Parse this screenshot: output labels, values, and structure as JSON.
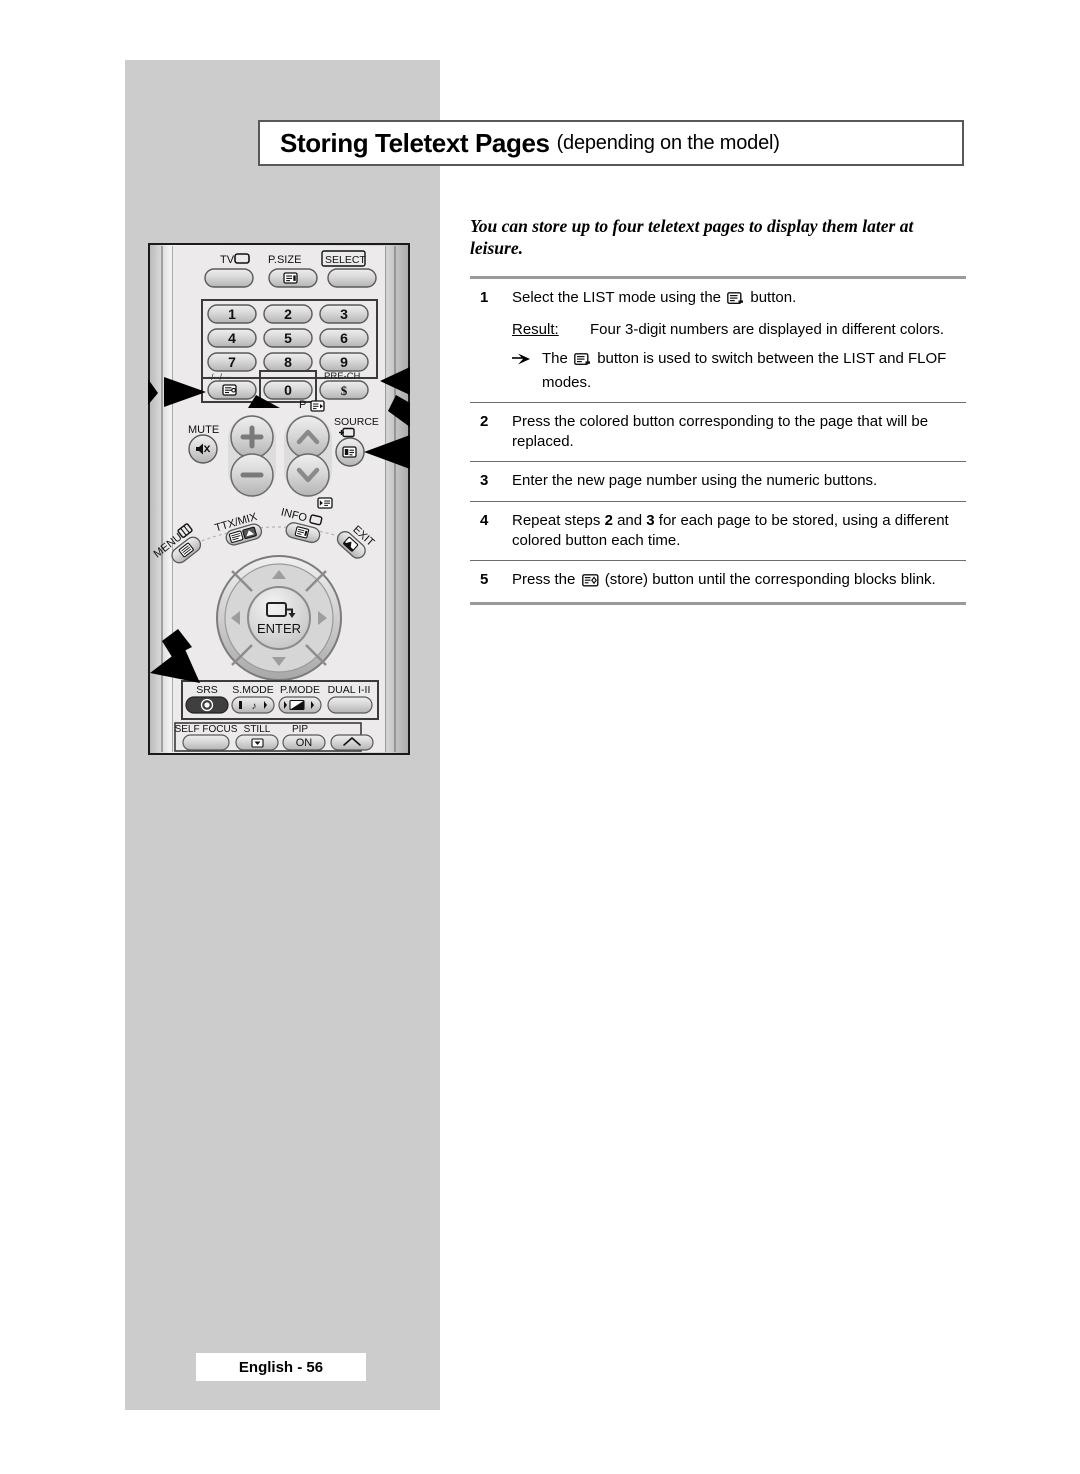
{
  "page": {
    "title_main": "Storing Teletext Pages",
    "title_sub": "(depending on the model)",
    "footer": "English - 56"
  },
  "intro": "You can store up to four teletext pages to display them later at leisure.",
  "steps": [
    {
      "num": "1",
      "text_before_icon": "Select the LIST mode using the",
      "icon": "teletext-list-icon",
      "text_after_icon": "button.",
      "result_label": "Result:",
      "result_text": "Four 3-digit numbers are displayed in different colors.",
      "note_before_icon": "The",
      "note_icon": "teletext-list-icon",
      "note_after_icon": "button is used to switch between the LIST and FLOF modes."
    },
    {
      "num": "2",
      "text": "Press the colored button corresponding to the page that will be replaced."
    },
    {
      "num": "3",
      "text": "Enter the new page number using the numeric buttons."
    },
    {
      "num": "4",
      "text_a": "Repeat steps",
      "bold_a": "2",
      "text_b": "and",
      "bold_b": "3",
      "text_c": "for each page to be stored, using a different colored button each time."
    },
    {
      "num": "5",
      "text_before_icon": "Press the",
      "icon": "teletext-store-icon",
      "text_after_icon": "(store) button until the corresponding blocks blink."
    }
  ],
  "remote": {
    "top_row": [
      {
        "label": "TV",
        "icon": "tv-screen-icon",
        "button": "plain"
      },
      {
        "label": "P.SIZE",
        "icon": "",
        "button": "picture-size-icon"
      },
      {
        "label": "SELECT",
        "icon": "",
        "button": "plain"
      }
    ],
    "numeric_keys": [
      "1",
      "2",
      "3",
      "4",
      "5",
      "6",
      "7",
      "8",
      "9",
      "0"
    ],
    "dash_label": "-/--/---",
    "pre_ch_label": "PRE-CH",
    "pre_ch_glyph": "$",
    "mute_label": "MUTE",
    "p_label": "P",
    "source_label": "SOURCE",
    "vol_plus": "+",
    "vol_minus": "−",
    "ttx_mix_label": "TTX/MIX",
    "info_label": "INFO",
    "menu_label": "MENU",
    "exit_label": "EXIT",
    "enter_label": "ENTER",
    "bottom_row_1": [
      "SRS",
      "S.MODE",
      "P.MODE",
      "DUAL I-II"
    ],
    "bottom_row_2": [
      "SELF FOCUS",
      "STILL",
      "PIP"
    ],
    "pip_on_label": "ON",
    "callout_count": 4
  },
  "colors": {
    "panel_gray": "#cccccc",
    "rule_light": "#9a9a9a",
    "rule_dark": "#6d6d6d",
    "title_border": "#58585a",
    "remote_body": "#e8e8e8",
    "remote_button": "#c9c9c9",
    "text": "#000000"
  }
}
